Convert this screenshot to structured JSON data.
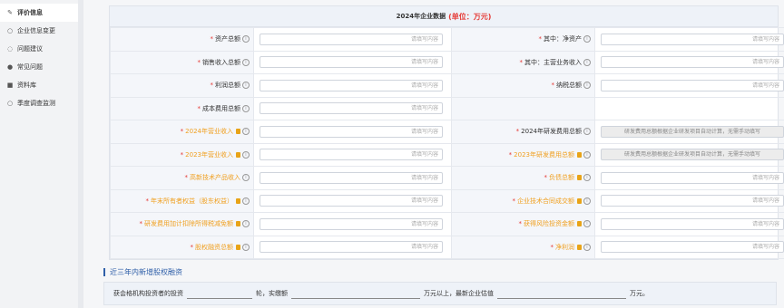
{
  "sidebar": {
    "items": [
      {
        "label": "评价信息",
        "icon": "edit-icon",
        "active": true
      },
      {
        "label": "企业信息变更",
        "icon": "circle-icon"
      },
      {
        "label": "问题建议",
        "icon": "chat-icon"
      },
      {
        "label": "常见问题",
        "icon": "question-icon"
      },
      {
        "label": "资料库",
        "icon": "folder-icon"
      },
      {
        "label": "季度调查监测",
        "icon": "circle-icon"
      }
    ]
  },
  "card": {
    "title": "2024年企业数据",
    "unit": "(单位：万元)",
    "placeholder": "请填写内容",
    "disabled_text": "研发费用总额根据企业研发项目自动计算，无需手动填写",
    "rows": [
      {
        "left": "资产总额",
        "right": "其中：净资产"
      },
      {
        "left": "销售收入总额",
        "right": "其中：主营业务收入"
      },
      {
        "left": "利润总额",
        "right": "纳税总额"
      },
      {
        "left": "成本费用总额",
        "right": ""
      },
      {
        "left": "2024年营业收入",
        "right": "2024年研发费用总额"
      },
      {
        "left": "2023年营业收入",
        "right": "2023年研发费用总额"
      },
      {
        "left": "高新技术产品收入",
        "right": "负债总额"
      },
      {
        "left": "年末所有者权益（股东权益）",
        "right": "企业技术合同成交额"
      },
      {
        "left": "研发费用加计扣除所得税减免额",
        "right": "获得风险投资金额"
      },
      {
        "left": "股权融资总额",
        "right": "净利润"
      }
    ]
  },
  "equity": {
    "title": "近三年内新增股权融资",
    "t1": "获会格机构投资者的投资",
    "t2": "轮，实缴额",
    "t3": "万元以上，最新企业估值",
    "t4": "万元。"
  }
}
